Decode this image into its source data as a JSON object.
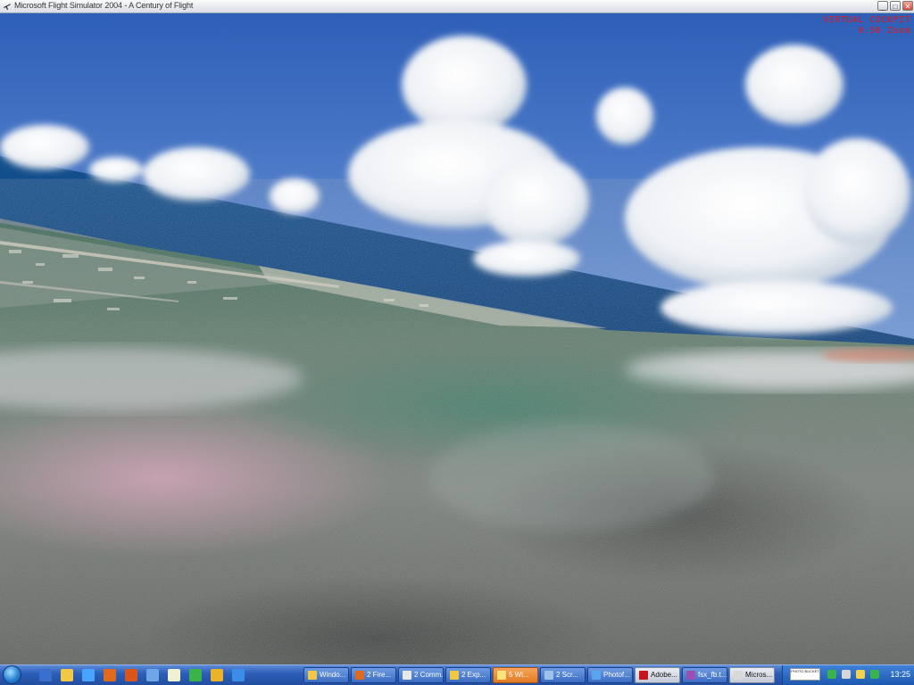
{
  "window": {
    "title": "Microsoft Flight Simulator 2004 - A Century of Flight",
    "controls": {
      "minimize": "_",
      "maximize": "□",
      "close": "✕"
    }
  },
  "hud": {
    "line1": "VIRTUAL COCKPIT",
    "line2": "0.50 Zoom",
    "color": "#e0161a"
  },
  "taskbar": {
    "start_icon": "windows-orb-icon",
    "quick_launch": [
      {
        "name": "show-desktop-icon",
        "color": "#3a6fd0"
      },
      {
        "name": "folder-icon",
        "color": "#f2c744"
      },
      {
        "name": "help-icon",
        "color": "#4aa3ff"
      },
      {
        "name": "firefox-icon",
        "color": "#e06a1b"
      },
      {
        "name": "shield-icon",
        "color": "#d8551c"
      },
      {
        "name": "window-icon",
        "color": "#6ea6e8"
      },
      {
        "name": "notepad-icon",
        "color": "#f1f1d2"
      },
      {
        "name": "media-icon",
        "color": "#3ab44a"
      },
      {
        "name": "chrome-icon",
        "color": "#e9b32a"
      },
      {
        "name": "globe-icon",
        "color": "#3a8ee8"
      }
    ],
    "tasks": [
      {
        "label": "Windo...",
        "icon": "explorer-icon",
        "icon_color": "#f2c744",
        "style": "normal"
      },
      {
        "label": "2 Fire...",
        "icon": "firefox-icon",
        "icon_color": "#e06a1b",
        "style": "normal"
      },
      {
        "label": "2 Comm...",
        "icon": "command-icon",
        "icon_color": "#e8e8e8",
        "style": "normal"
      },
      {
        "label": "2 Exp...",
        "icon": "folder-icon",
        "icon_color": "#f2c744",
        "style": "normal"
      },
      {
        "label": "5 Wi...",
        "icon": "folder-icon",
        "icon_color": "#fbe27a",
        "style": "active"
      },
      {
        "label": "2 Scr...",
        "icon": "image-icon",
        "icon_color": "#9ec3ea",
        "style": "normal"
      },
      {
        "label": "Photof...",
        "icon": "photo-icon",
        "icon_color": "#5aa6ee",
        "style": "normal"
      },
      {
        "label": "Adobe...",
        "icon": "acrobat-icon",
        "icon_color": "#c4161c",
        "style": "light"
      },
      {
        "label": "fsx_fb.t...",
        "icon": "archive-icon",
        "icon_color": "#9a4fb0",
        "style": "normal"
      },
      {
        "label": "Micros...",
        "icon": "plane-icon",
        "icon_color": "#d9d9d9",
        "style": "light"
      }
    ],
    "tray": {
      "badge_text": "PHOTO BUCKET",
      "icons": [
        {
          "name": "arrow-icon",
          "color": "#3ab44a"
        },
        {
          "name": "volume-icon",
          "color": "#d6d6d6"
        },
        {
          "name": "network-icon",
          "color": "#f1d24a"
        },
        {
          "name": "security-icon",
          "color": "#3ab44a"
        }
      ],
      "clock": "13:25"
    }
  }
}
